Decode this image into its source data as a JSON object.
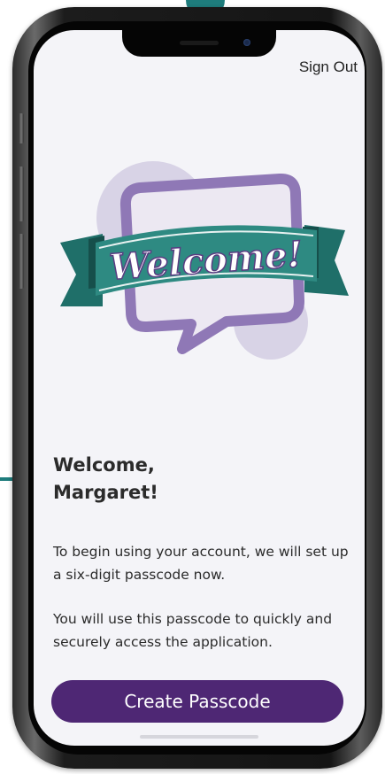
{
  "header": {
    "sign_out_label": "Sign Out"
  },
  "illustration": {
    "banner_text": "Welcome!",
    "icon": "speech-bubble-with-welcome-banner",
    "colors": {
      "banner": "#2e8a82",
      "banner_dark": "#1d5f5a",
      "bubble": "#8f78b6",
      "bubble_fill": "#ece8f2",
      "blob": "#d8d3e6"
    }
  },
  "main": {
    "heading_line1": "Welcome,",
    "heading_line2": "Margaret!",
    "paragraph1": "To begin using your account, we will set up a six-digit passcode now.",
    "paragraph2": "You will use this passcode to quickly and securely access the application."
  },
  "actions": {
    "create_passcode_label": "Create Passcode"
  },
  "theme": {
    "primary": "#4e2774",
    "accent": "#1e7c7c",
    "screen_background": "#f4f4f8"
  }
}
